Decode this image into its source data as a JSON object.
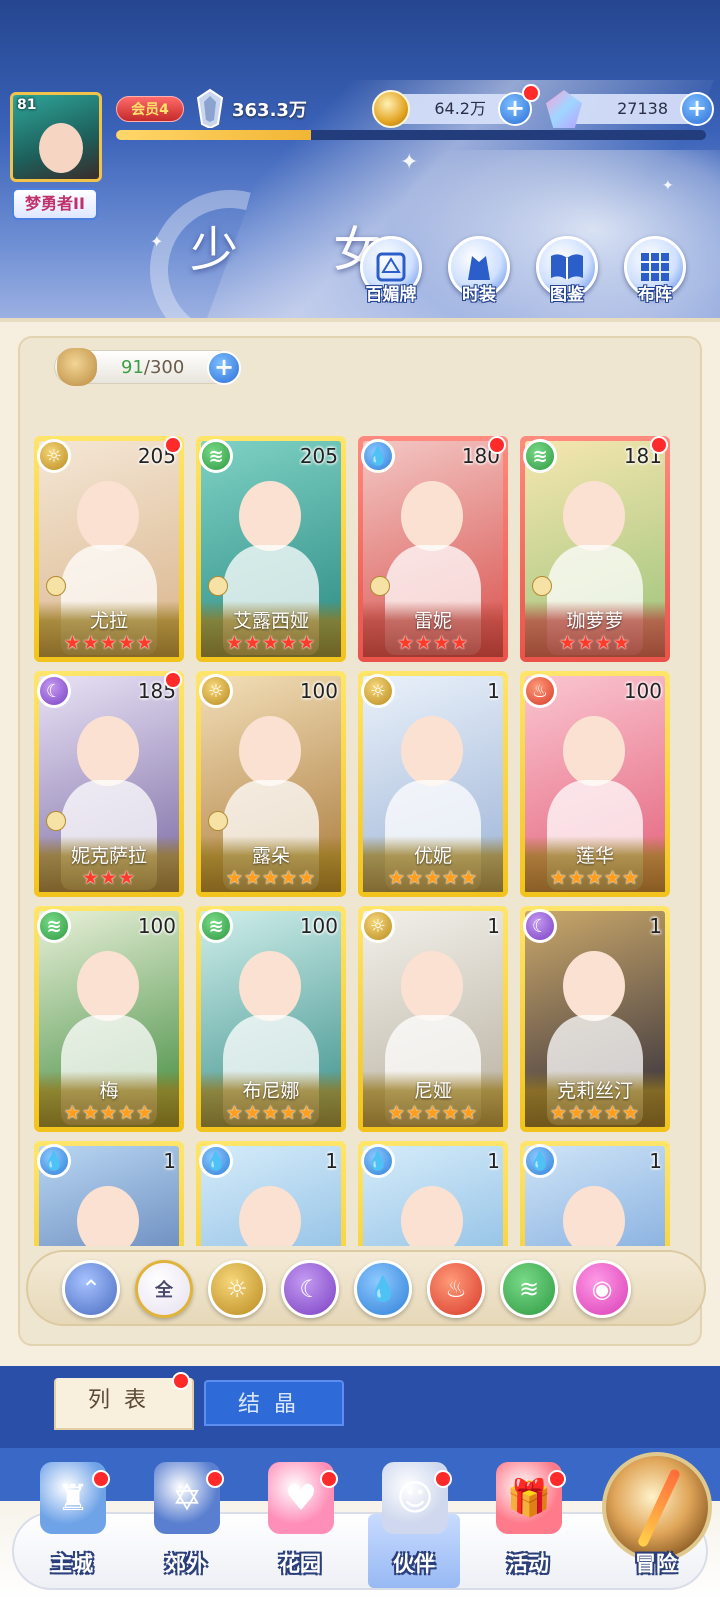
{
  "player": {
    "level": "81",
    "rank_title": "梦勇者II",
    "vip": "会员4",
    "power": "363.3万",
    "exp_fraction": 0.33
  },
  "currencies": {
    "gold": "64.2万",
    "gems": "27138"
  },
  "page": {
    "title": "少 女"
  },
  "quick_buttons": [
    {
      "label": "百媚牌",
      "icon": "card-deck-icon"
    },
    {
      "label": "时装",
      "icon": "outfit-icon"
    },
    {
      "label": "图鉴",
      "icon": "book-icon"
    },
    {
      "label": "布阵",
      "icon": "formation-grid-icon"
    }
  ],
  "capacity": {
    "current": "91",
    "max": "/300"
  },
  "cards": [
    {
      "name": "尤拉",
      "level": "205",
      "element": "light",
      "stars": "★★★★★",
      "star_color": "red",
      "frame": "gold",
      "dot": true,
      "lock": true
    },
    {
      "name": "艾露西娅",
      "level": "205",
      "element": "wind",
      "stars": "★★★★★",
      "star_color": "red",
      "frame": "gold",
      "dot": false,
      "lock": true
    },
    {
      "name": "雷妮",
      "level": "180",
      "element": "water",
      "stars": "★★★★",
      "star_color": "red",
      "frame": "red",
      "dot": true,
      "lock": true
    },
    {
      "name": "珈萝萝",
      "level": "181",
      "element": "wind",
      "stars": "★★★★",
      "star_color": "red",
      "frame": "red",
      "dot": true,
      "lock": true
    },
    {
      "name": "妮克萨拉",
      "level": "185",
      "element": "dark",
      "stars": "★★★",
      "star_color": "red",
      "frame": "gold",
      "dot": true,
      "lock": true
    },
    {
      "name": "露朵",
      "level": "100",
      "element": "light",
      "stars": "★★★★★",
      "star_color": "orange",
      "frame": "gold",
      "dot": false,
      "lock": true
    },
    {
      "name": "优妮",
      "level": "1",
      "element": "light",
      "stars": "★★★★★",
      "star_color": "orange",
      "frame": "gold",
      "dot": false,
      "lock": false
    },
    {
      "name": "莲华",
      "level": "100",
      "element": "fire",
      "stars": "★★★★★",
      "star_color": "orange",
      "frame": "gold",
      "dot": false,
      "lock": false
    },
    {
      "name": "梅",
      "level": "100",
      "element": "wind",
      "stars": "★★★★★",
      "star_color": "orange",
      "frame": "gold",
      "dot": false,
      "lock": false
    },
    {
      "name": "布尼娜",
      "level": "100",
      "element": "wind",
      "stars": "★★★★★",
      "star_color": "orange",
      "frame": "gold",
      "dot": false,
      "lock": false
    },
    {
      "name": "尼娅",
      "level": "1",
      "element": "light",
      "stars": "★★★★★",
      "star_color": "orange",
      "frame": "gold",
      "dot": false,
      "lock": false
    },
    {
      "name": "克莉丝汀",
      "level": "1",
      "element": "dark",
      "stars": "★★★★★",
      "star_color": "orange",
      "frame": "gold",
      "dot": false,
      "lock": false
    },
    {
      "name": "",
      "level": "1",
      "element": "water",
      "stars": "",
      "star_color": "orange",
      "frame": "gold",
      "dot": false,
      "lock": false
    },
    {
      "name": "",
      "level": "1",
      "element": "water",
      "stars": "",
      "star_color": "orange",
      "frame": "gold",
      "dot": false,
      "lock": false
    },
    {
      "name": "",
      "level": "1",
      "element": "water",
      "stars": "",
      "star_color": "orange",
      "frame": "gold",
      "dot": false,
      "lock": false
    },
    {
      "name": "",
      "level": "1",
      "element": "water",
      "stars": "",
      "star_color": "orange",
      "frame": "gold",
      "dot": false,
      "lock": false
    }
  ],
  "filters": [
    {
      "key": "base",
      "label": ""
    },
    {
      "key": "all",
      "label": "全"
    },
    {
      "key": "light",
      "label": ""
    },
    {
      "key": "dark",
      "label": ""
    },
    {
      "key": "water",
      "label": ""
    },
    {
      "key": "fire",
      "label": ""
    },
    {
      "key": "wind",
      "label": ""
    },
    {
      "key": "pink",
      "label": ""
    }
  ],
  "tabs": {
    "list": "列表",
    "crystal": "结晶"
  },
  "nav": [
    {
      "label": "主城",
      "icon": "castle-icon",
      "dot": true
    },
    {
      "label": "郊外",
      "icon": "magic-circle-icon",
      "dot": true
    },
    {
      "label": "花园",
      "icon": "heart-icon",
      "dot": true
    },
    {
      "label": "伙伴",
      "icon": "partner-portrait-icon",
      "dot": true,
      "active": true
    },
    {
      "label": "活动",
      "icon": "gift-box-icon",
      "dot": true
    },
    {
      "label": "冒险",
      "icon": "compass-icon",
      "dot": false
    }
  ],
  "colors": {
    "header_blue": "#25468f",
    "panel_cream": "#f6efe0",
    "card_gold": "#f2c31c",
    "card_red": "#e9534a",
    "accent_blue": "#2b6fd8",
    "alert_red": "#ff2b2b"
  }
}
